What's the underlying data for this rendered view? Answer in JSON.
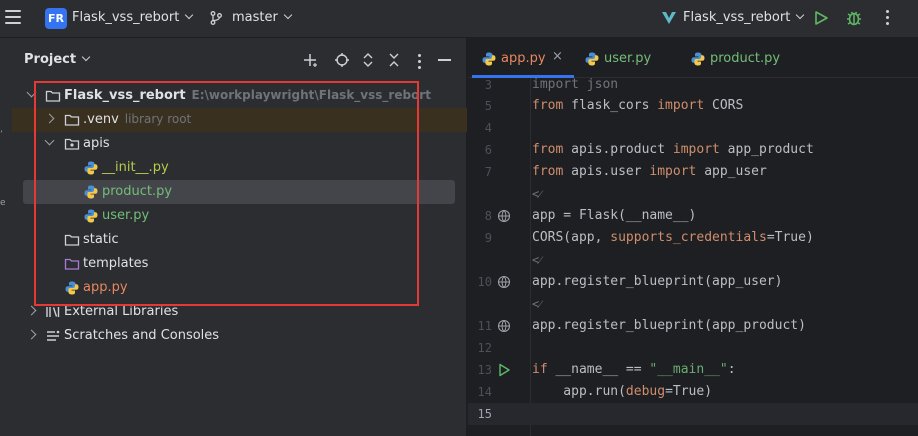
{
  "topbar": {
    "project_badge": "FR",
    "project_name": "Flask_vss_rebort",
    "branch": "master",
    "run_config": "Flask_vss_rebort"
  },
  "panel": {
    "title": "Project",
    "tree": [
      {
        "label": "Flask_vss_rebort",
        "hint": "E:\\workplaywright\\Flask_vss_rebort"
      },
      {
        "label": ".venv",
        "hint": "library root"
      },
      {
        "label": "apis"
      },
      {
        "label": "__init__.py"
      },
      {
        "label": "product.py"
      },
      {
        "label": "user.py"
      },
      {
        "label": "static"
      },
      {
        "label": "templates"
      },
      {
        "label": "app.py"
      },
      {
        "label": "External Libraries"
      },
      {
        "label": "Scratches and Consoles"
      }
    ]
  },
  "editor": {
    "tabs": [
      {
        "label": "app.py",
        "close": "×"
      },
      {
        "label": "user.py"
      },
      {
        "label": "product.py"
      }
    ],
    "lines": [
      {
        "num": "3",
        "code": "import json"
      },
      {
        "num": "",
        "code": ""
      },
      {
        "num": "4",
        "code": ""
      },
      {
        "num": "6",
        "code": ""
      },
      {
        "num": "7",
        "code": ""
      },
      {
        "num": "",
        "code": "<⁄"
      },
      {
        "num": "8",
        "code": ""
      },
      {
        "num": "9",
        "code": ""
      },
      {
        "num": "",
        "code": "<⁄"
      },
      {
        "num": "10",
        "code": "app.register_blueprint(app_user)"
      },
      {
        "num": "",
        "code": "<⁄"
      },
      {
        "num": "11",
        "code": "app.register_blueprint(app_product)"
      },
      {
        "num": "12",
        "code": ""
      },
      {
        "num": "13",
        "code": ""
      },
      {
        "num": "14",
        "code": ""
      },
      {
        "num": "15",
        "code": ""
      }
    ],
    "tokens": {
      "from": "from",
      "import": "import",
      "flask_cors": " flask_cors ",
      "CORS": " CORS",
      "apis_product": " apis.product ",
      "app_product": " app_product",
      "apis_user": " apis.user ",
      "app_user": " app_user",
      "flask_assign": "app = Flask(__name__)",
      "cors_open": "CORS(app, ",
      "supports_credentials": "supports_credentials",
      "eq_true": "=True)",
      "if": "if",
      "if_mid": " __name__ == ",
      "main_str": "\"__main__\"",
      "colon": ":",
      "run_open": "    app.run(",
      "debug": "debug",
      "run_close": "=True)"
    }
  }
}
